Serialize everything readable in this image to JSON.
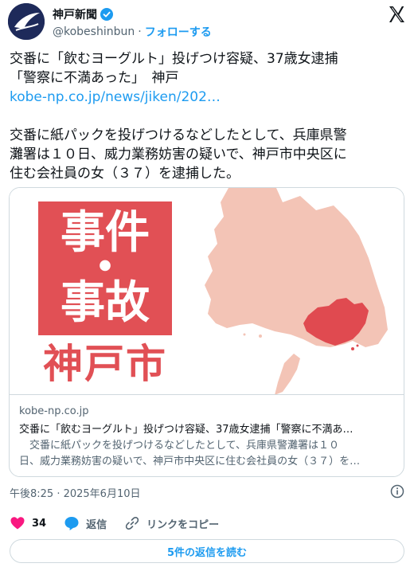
{
  "account": {
    "display_name": "神戸新聞",
    "handle": "@kobeshinbun",
    "separator": "·",
    "follow_label": "フォローする"
  },
  "tweet": {
    "headline_line1": "交番に「飲むヨーグルト」投げつけ容疑、37歳女逮捕",
    "headline_line2": "「警察に不満あった」　神戸",
    "link": "kobe-np.co.jp/news/jiken/202…",
    "body_line1": "交番に紙パックを投げつけるなどしたとして、兵庫県警",
    "body_line2": "灘署は１０日、威力業務妨害の疑いで、神戸市中央区に",
    "body_line3": "住む会社員の女（３７）を逮捕した。"
  },
  "card": {
    "image_text_1": "事件",
    "image_text_2": "・",
    "image_text_3": "事故",
    "image_text_city": "神戸市",
    "domain": "kobe-np.co.jp",
    "title": "交番に「飲むヨーグルト」投げつけ容疑、37歳女逮捕「警察に不満あ…",
    "desc_line1": "　交番に紙パックを投げつけるなどしたとして、兵庫県警灘署は１０",
    "desc_line2": "日、威力業務妨害の疑いで、神戸市中央区に住む会社員の女（３７）を…"
  },
  "timestamp": "午後8:25 · 2025年6月10日",
  "actions": {
    "like_count": "34",
    "reply_label": "返信",
    "copy_link_label": "リンクをコピー"
  },
  "read_replies_label": "5件の返信を読む",
  "colors": {
    "accent": "#1d9bf0",
    "like": "#f91880",
    "card_red": "#e15055",
    "map_light": "#f3c4b6",
    "map_highlight": "#e04a50"
  }
}
